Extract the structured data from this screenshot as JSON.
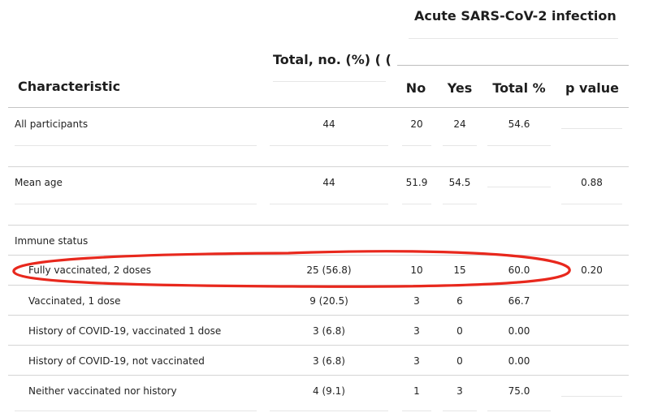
{
  "header": {
    "group_title": "Acute SARS-CoV-2 infection",
    "total_col": "Total, no. (%) ( (",
    "characteristic": "Characteristic",
    "no": "No",
    "yes": "Yes",
    "total_pct": "Total %",
    "p_value": "p value"
  },
  "rows": [
    {
      "label": "All participants",
      "total": "44",
      "no": "20",
      "yes": "24",
      "total_pct": "54.6",
      "p": ""
    },
    {
      "label": "Mean age",
      "total": "44",
      "no": "51.9",
      "yes": "54.5",
      "total_pct": "",
      "p": "0.88"
    },
    {
      "label": "Immune status",
      "total": "",
      "no": "",
      "yes": "",
      "total_pct": "",
      "p": ""
    },
    {
      "label": "Fully vaccinated, 2 doses",
      "total": "25 (56.8)",
      "no": "10",
      "yes": "15",
      "total_pct": "60.0",
      "p": "0.20"
    },
    {
      "label": "Vaccinated, 1 dose",
      "total": "9 (20.5)",
      "no": "3",
      "yes": "6",
      "total_pct": "66.7",
      "p": ""
    },
    {
      "label": "History of COVID-19, vaccinated 1 dose",
      "total": "3 (6.8)",
      "no": "3",
      "yes": "0",
      "total_pct": "0.00",
      "p": ""
    },
    {
      "label": "History of COVID-19, not vaccinated",
      "total": "3 (6.8)",
      "no": "3",
      "yes": "0",
      "total_pct": "0.00",
      "p": ""
    },
    {
      "label": "Neither vaccinated nor history",
      "total": "4 (9.1)",
      "no": "1",
      "yes": "3",
      "total_pct": "75.0",
      "p": ""
    }
  ],
  "highlight": {
    "color": "#e8281d"
  }
}
